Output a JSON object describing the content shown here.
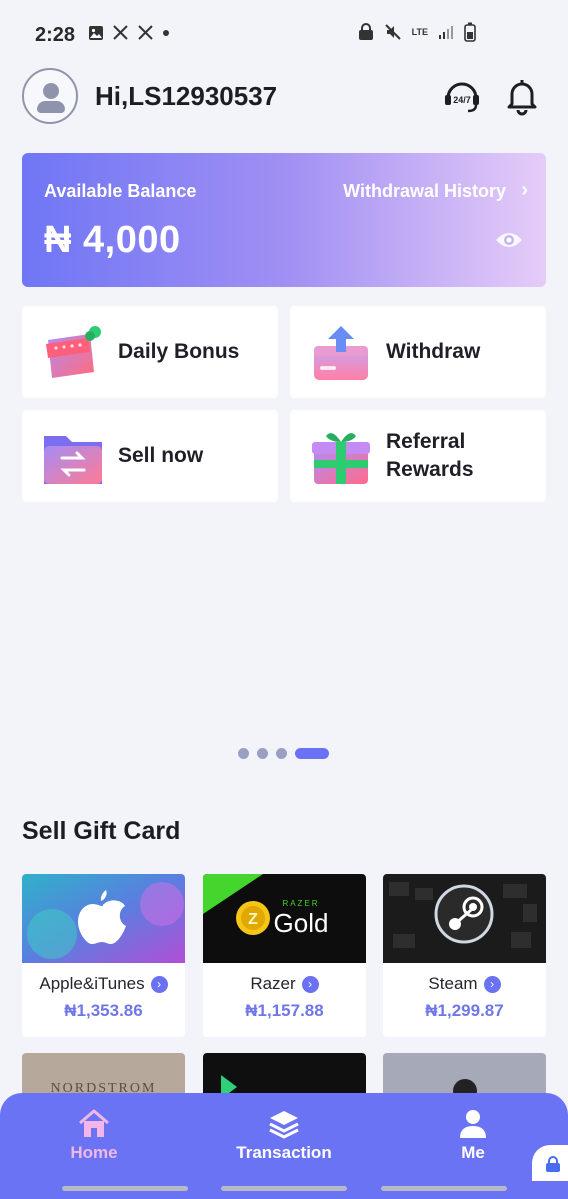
{
  "status_bar": {
    "time": "2:28",
    "network": "LTE"
  },
  "header": {
    "greeting": "Hi,LS12930537",
    "support_badge": "24/7"
  },
  "balance": {
    "label": "Available Balance",
    "history_link": "Withdrawal History",
    "value": "₦ 4,000"
  },
  "actions": [
    {
      "label": "Daily Bonus"
    },
    {
      "label": "Withdraw"
    },
    {
      "label": "Sell now"
    },
    {
      "label": "Referral Rewards"
    }
  ],
  "carousel": {
    "total": 4,
    "active_index": 3
  },
  "gift_cards": {
    "title": "Sell Gift Card",
    "items": [
      {
        "name": "Apple&iTunes",
        "price": "₦1,353.86"
      },
      {
        "name": "Razer",
        "price": "₦1,157.88",
        "brand_top": "RAZER",
        "brand_main": "Gold"
      },
      {
        "name": "Steam",
        "price": "₦1,299.87"
      }
    ],
    "partial_row_texts": [
      "NORDSTROM"
    ]
  },
  "bottom_nav": {
    "items": [
      {
        "label": "Home",
        "active": true
      },
      {
        "label": "Transaction",
        "active": false
      },
      {
        "label": "Me",
        "active": false
      }
    ]
  },
  "colors": {
    "accent": "#6b73f5",
    "price": "#6f77e8",
    "active_nav": "#f2b7e6"
  }
}
